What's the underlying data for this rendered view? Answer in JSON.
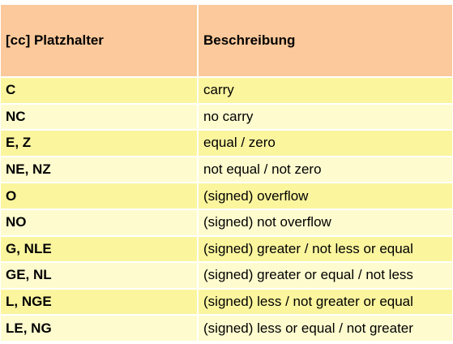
{
  "table": {
    "headers": [
      "[cc] Platzhalter",
      "Beschreibung"
    ],
    "rows": [
      {
        "code": "C",
        "description": "carry"
      },
      {
        "code": "NC",
        "description": "no carry"
      },
      {
        "code": "E, Z",
        "description": "equal / zero"
      },
      {
        "code": "NE, NZ",
        "description": "not equal / not zero"
      },
      {
        "code": "O",
        "description": "(signed) overflow"
      },
      {
        "code": "NO",
        "description": "(signed) not overflow"
      },
      {
        "code": "G, NLE",
        "description": "(signed) greater / not less or equal"
      },
      {
        "code": "GE, NL",
        "description": "(signed) greater or equal / not less"
      },
      {
        "code": "L, NGE",
        "description": "(signed) less / not greater or equal"
      },
      {
        "code": "LE, NG",
        "description": "(signed) less or equal / not greater"
      }
    ]
  },
  "colors": {
    "header_bg": "#fbc99b",
    "row_odd_bg": "#fbf59e",
    "row_even_bg": "#fefccf",
    "border": "#ffffff"
  }
}
